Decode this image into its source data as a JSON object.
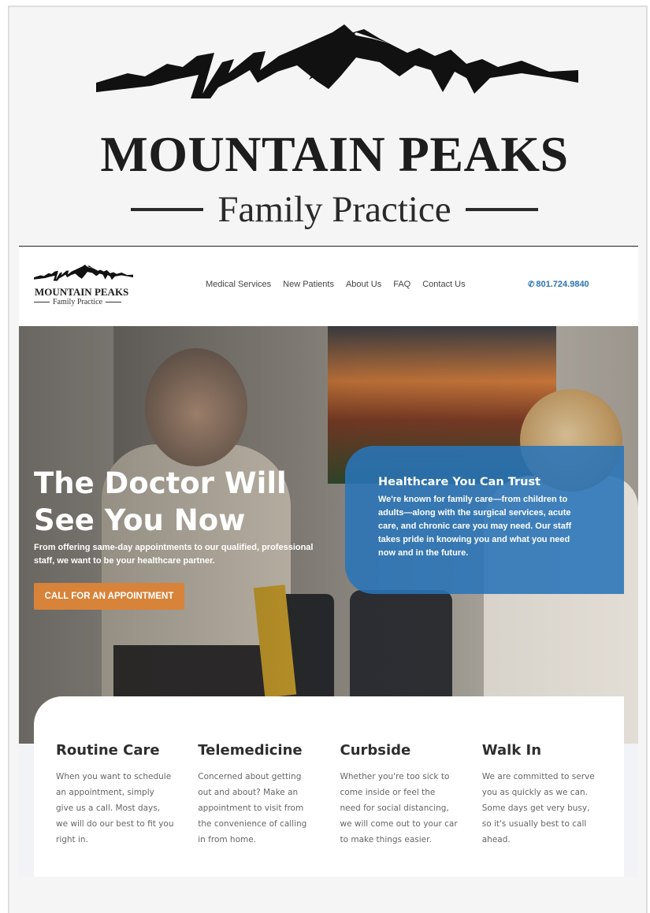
{
  "logo": {
    "name": "MOUNTAIN PEAKS",
    "subtitle": "Family Practice"
  },
  "nav": {
    "items": [
      "Medical Services",
      "New Patients",
      "About Us",
      "FAQ",
      "Contact Us"
    ],
    "phone": "801.724.9840",
    "phone_icon": "phone-icon"
  },
  "hero": {
    "title": "The Doctor Will See You Now",
    "lead": "From offering same-day appointments to our qualified, professional staff, we want to be your healthcare partner.",
    "cta_label": "CALL FOR AN APPOINTMENT"
  },
  "trust_box": {
    "title": "Healthcare You Can Trust",
    "body": "We're known for family care—from children to adults—along with the surgical services, acute care, and chronic care you may need. Our staff takes pride in knowing you and what you need now and in the future."
  },
  "services": [
    {
      "title": "Routine Care",
      "body": "When you want to schedule an appointment, simply give us a call. Most days, we will do our best to fit you right in."
    },
    {
      "title": "Telemedicine",
      "body": "Concerned about getting out and about? Make an appointment to visit from the convenience of calling in from home."
    },
    {
      "title": "Curbside",
      "body": "Whether you're too sick to come inside or feel the need for social distancing, we will come out to your car to make things easier."
    },
    {
      "title": "Walk In",
      "body": "We are committed to serve you as quickly as we can. Some days get very busy, so it's usually best to call ahead."
    }
  ],
  "colors": {
    "accent_blue": "#2b73b6",
    "cta_orange": "#d8833a"
  }
}
